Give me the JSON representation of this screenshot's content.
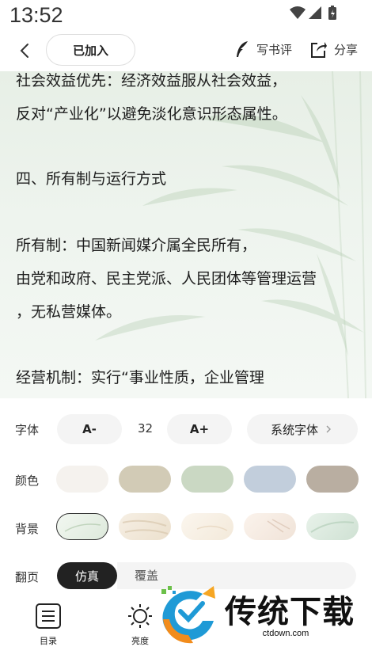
{
  "status_bar": {
    "time": "13:52"
  },
  "toolbar": {
    "joined_label": "已加入",
    "review_label": "写书评",
    "share_label": "分享"
  },
  "reader": {
    "lines": [
      "社会效益优先：经济效益服从社会效益，",
      "反对“产业化”以避免淡化意识形态属性。",
      "四、所有制与运行方式",
      "所有制：中国新闻媒介属全民所有，",
      "由党和政府、民主党派、人民团体等管理运营",
      "，无私营媒体。",
      "经营机制：实行“事业性质，企业管理"
    ]
  },
  "settings": {
    "font": {
      "label": "字体",
      "decrease_label": "A-",
      "size": "32",
      "increase_label": "A+",
      "family_label": "系统字体"
    },
    "color": {
      "label": "颜色",
      "swatches": [
        "#f5f2ee",
        "#d2cbb6",
        "#cad8c3",
        "#c2cedc",
        "#b9aea1"
      ]
    },
    "background": {
      "label": "背景",
      "selected_index": 0
    },
    "page_turn": {
      "label": "翻页",
      "active_option": "仿真",
      "next_option": "覆盖"
    }
  },
  "bottom_nav": {
    "toc_label": "目录",
    "brightness_label": "亮度"
  },
  "watermark": {
    "text": "传统下载",
    "url": "ctdown.com"
  }
}
